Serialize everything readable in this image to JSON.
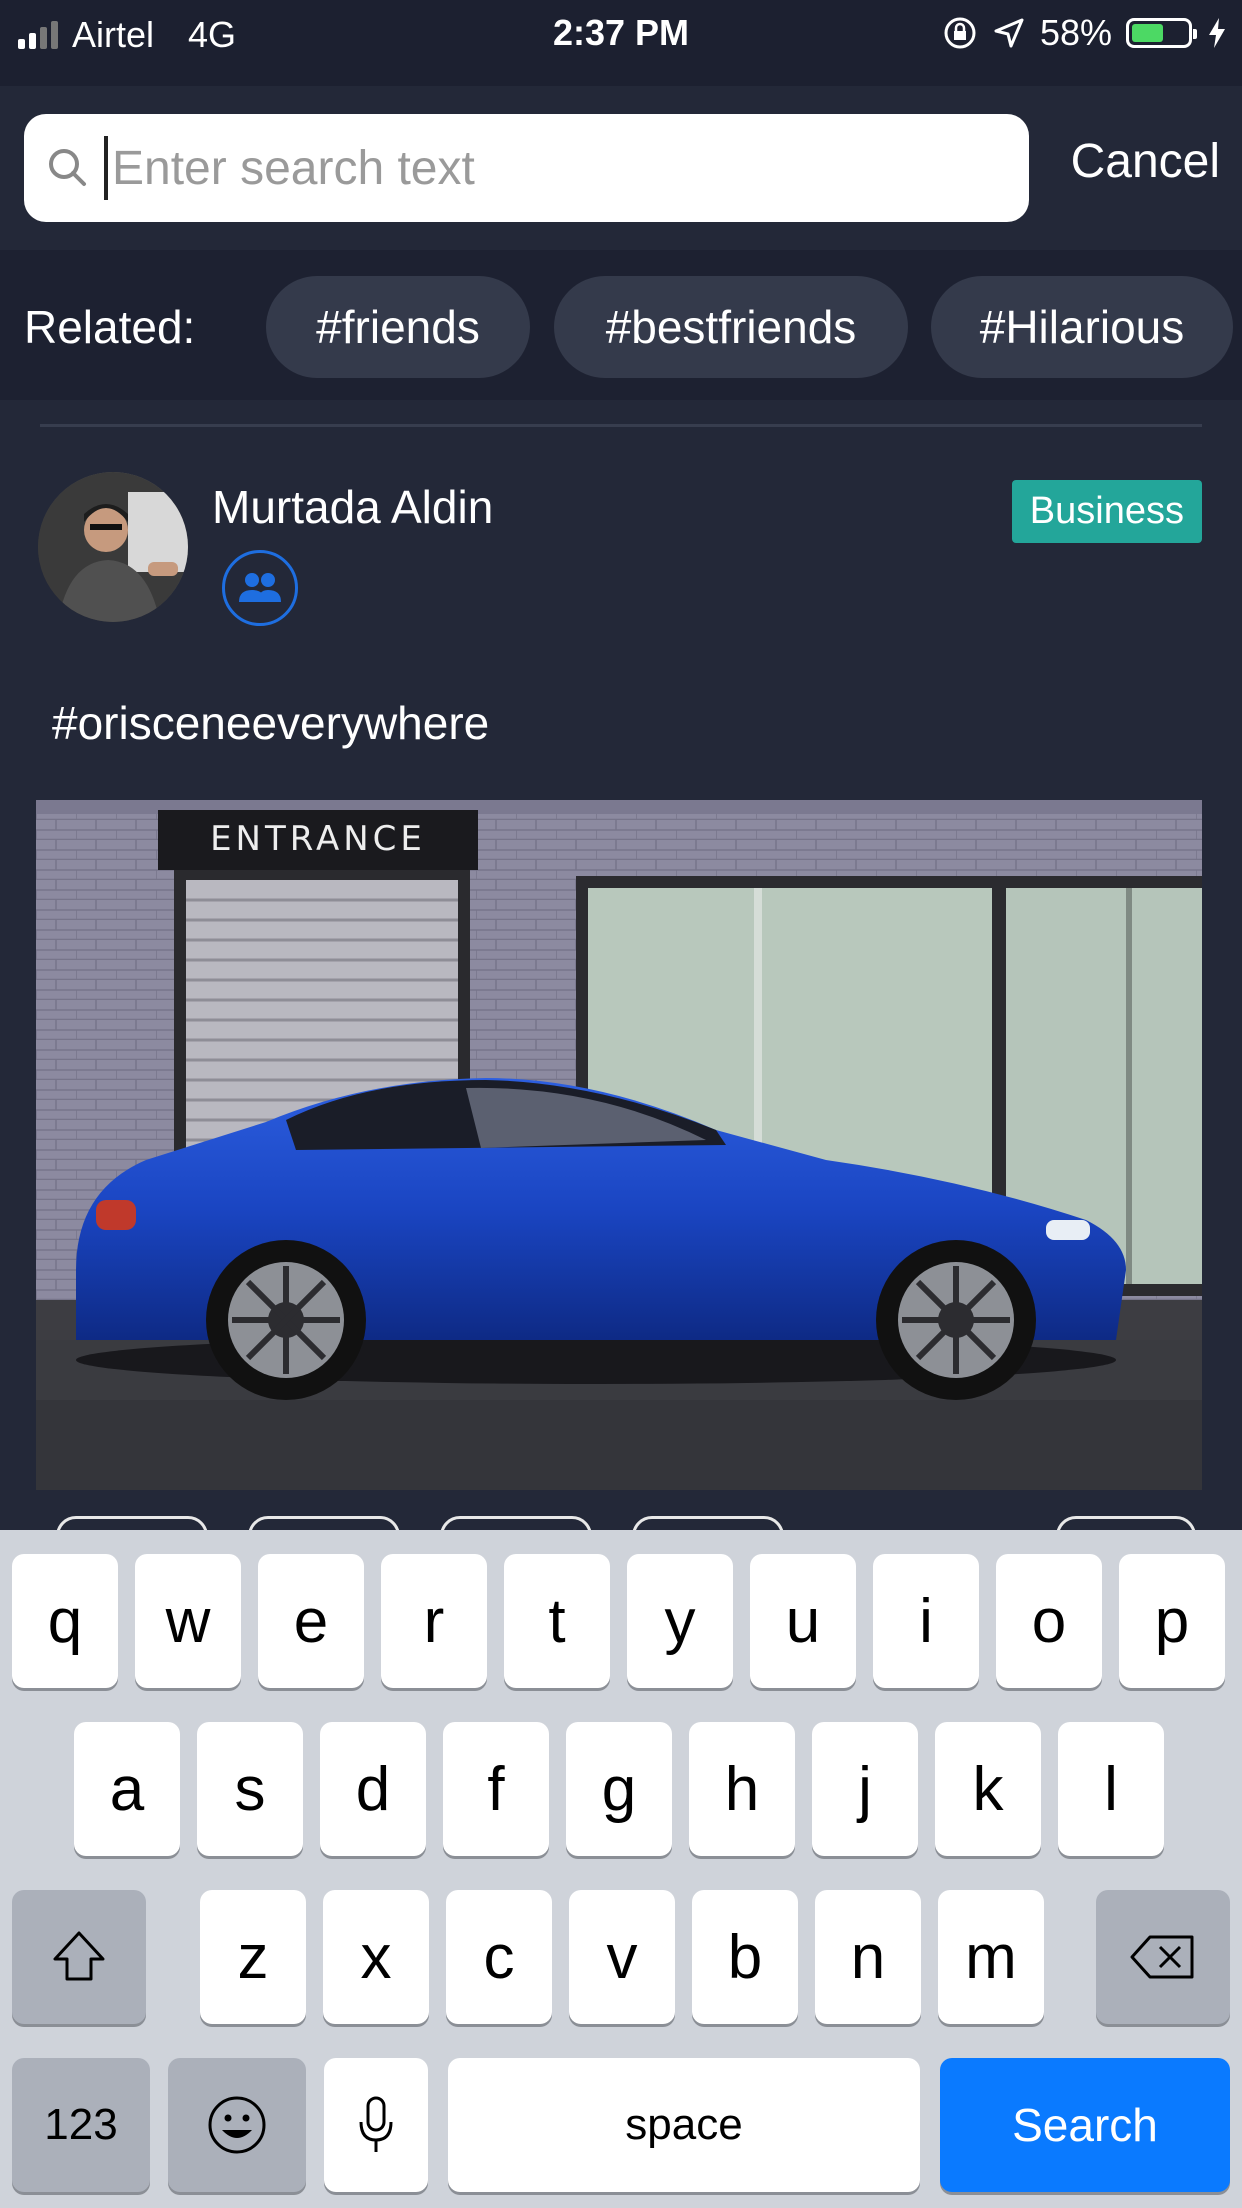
{
  "status_bar": {
    "carrier": "Airtel",
    "network": "4G",
    "time": "2:37 PM",
    "battery": "58%",
    "battery_level": 0.58
  },
  "search": {
    "placeholder": "Enter search text",
    "value": "",
    "cancel_label": "Cancel"
  },
  "related": {
    "label": "Related:",
    "tags": [
      "#friends",
      "#bestfriends",
      "#Hilarious"
    ]
  },
  "post": {
    "author": "Murtada Aldin",
    "badge": "Business",
    "caption": "#orisceneeverywhere",
    "photo_sign": "ENTRANCE"
  },
  "keyboard": {
    "row1": [
      "q",
      "w",
      "e",
      "r",
      "t",
      "y",
      "u",
      "i",
      "o",
      "p"
    ],
    "row2": [
      "a",
      "s",
      "d",
      "f",
      "g",
      "h",
      "j",
      "k",
      "l"
    ],
    "row3": [
      "z",
      "x",
      "c",
      "v",
      "b",
      "n",
      "m"
    ],
    "numbers_label": "123",
    "space_label": "space",
    "action_label": "Search"
  },
  "colors": {
    "background": "#232838",
    "accent_blue": "#0a7aff",
    "badge_teal": "#23a69a"
  }
}
